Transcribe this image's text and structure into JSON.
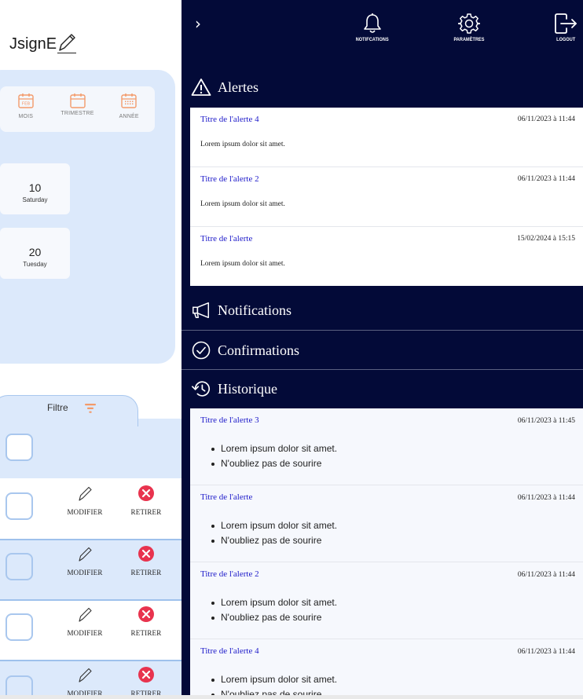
{
  "user": {
    "name": "JsignE"
  },
  "period": {
    "options": [
      {
        "label": "MOIS",
        "icon": "calendar-month-icon"
      },
      {
        "label": "TRIMESTRE",
        "icon": "calendar-quarter-icon"
      },
      {
        "label": "ANNÉE",
        "icon": "calendar-year-icon"
      }
    ]
  },
  "dates": [
    {
      "num": "10",
      "day": "Saturday"
    },
    {
      "num": "20",
      "day": "Tuesday"
    }
  ],
  "filter": {
    "label": "Filtre"
  },
  "table": {
    "modify_label": "MODIFIER",
    "remove_label": "RETIRER",
    "rows": [
      {
        "modify": "MODIFIER",
        "remove": "RETIRER"
      },
      {
        "modify": "MODIFIER",
        "remove": "RETIRER"
      },
      {
        "modify": "MODIFIER",
        "remove": "RETIRER"
      },
      {
        "modify": "MODIFIER",
        "remove": "RETIRER"
      }
    ]
  },
  "topbar": {
    "notifications": "NOTIFCATIONS",
    "settings": "PARAMÈTRES",
    "logout": "LOGOUT"
  },
  "sections": {
    "alerts": "Alertes",
    "notifications": "Notifications",
    "confirmations": "Confirmations",
    "history": "Historique"
  },
  "alerts": [
    {
      "title": "Titre de l'alerte 4",
      "date": "06/11/2023 à 11:44",
      "body": "Lorem ipsum dolor sit amet."
    },
    {
      "title": "Titre de l'alerte 2",
      "date": "06/11/2023 à 11:44",
      "body": "Lorem ipsum dolor sit amet."
    },
    {
      "title": "Titre de l'alerte",
      "date": "15/02/2024 à 15:15",
      "body": "Lorem ipsum dolor sit amet."
    }
  ],
  "history": [
    {
      "title": "Titre de l'alerte 3",
      "date": "06/11/2023 à 11:45",
      "items": [
        "Lorem ipsum dolor sit amet.",
        "N'oubliez pas de sourire"
      ]
    },
    {
      "title": "Titre de l'alerte",
      "date": "06/11/2023 à 11:44",
      "items": [
        "Lorem ipsum dolor sit amet.",
        "N'oubliez pas de sourire"
      ]
    },
    {
      "title": "Titre de l'alerte 2",
      "date": "06/11/2023 à 11:44",
      "items": [
        "Lorem ipsum dolor sit amet.",
        "N'oubliez pas de sourire"
      ]
    },
    {
      "title": "Titre de l'alerte 4",
      "date": "06/11/2023 à 11:44",
      "items": [
        "Lorem ipsum dolor sit amet.",
        "N'oubliez pas de sourire"
      ]
    }
  ],
  "colors": {
    "panel_navy": "#030a38",
    "light_blue": "#dce9fb",
    "accent_orange": "#f39a6a",
    "link_blue": "#1d1ac9",
    "danger_red": "#e8334e"
  }
}
